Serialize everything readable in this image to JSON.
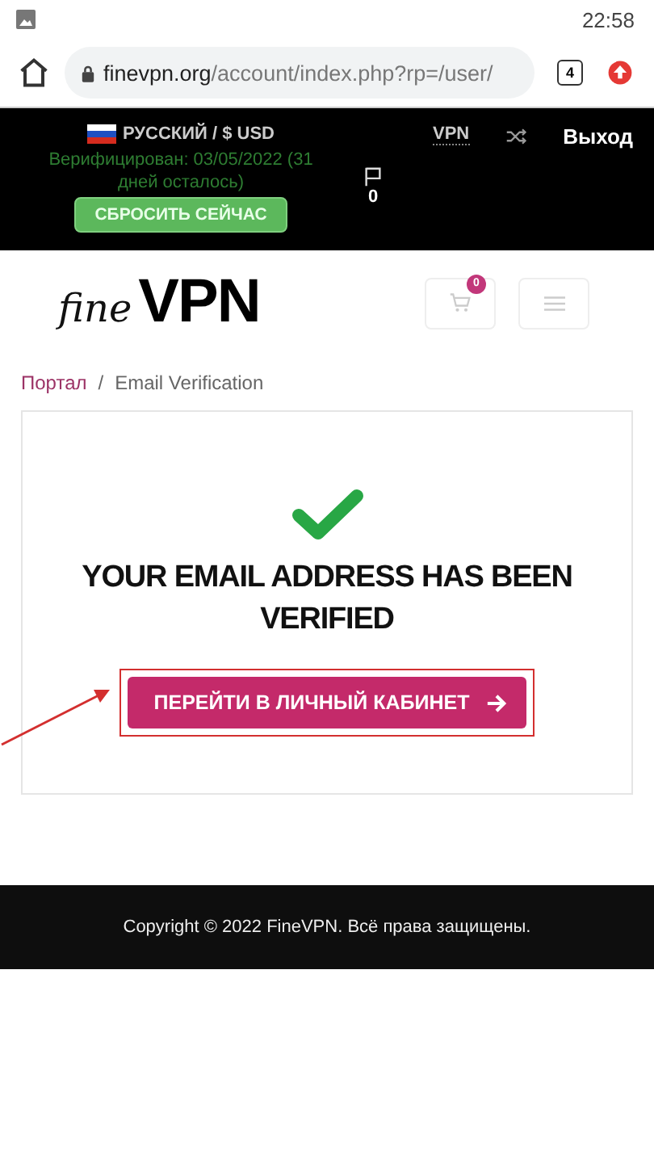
{
  "status_bar": {
    "time": "22:58"
  },
  "browser": {
    "url_domain": "finevpn.org",
    "url_path": "/account/index.php?rp=/user/",
    "tab_count": "4"
  },
  "top_bar": {
    "language": "РУССКИЙ / $ USD",
    "verified_text": "Верифицирован: 03/05/2022 (31 дней осталось)",
    "reset_button": "СБРОСИТЬ СЕЙЧАС",
    "flag_count": "0",
    "vpn_link": "VPN",
    "logout": "Выход"
  },
  "header": {
    "logo_script": "fine",
    "logo_bold": "VPN",
    "cart_count": "0"
  },
  "breadcrumb_separator": "/",
  "breadcrumb": [
    {
      "label": "Портал",
      "kind": "link"
    },
    {
      "label": "Email Verification",
      "kind": "current"
    }
  ],
  "card": {
    "title": "YOUR EMAIL ADDRESS HAS BEEN VERIFIED",
    "button": "ПЕРЕЙТИ В ЛИЧНЫЙ КАБИНЕТ",
    "highlighted": true
  },
  "footer": {
    "text": "Copyright © 2022 FineVPN. Всё права защищены."
  }
}
